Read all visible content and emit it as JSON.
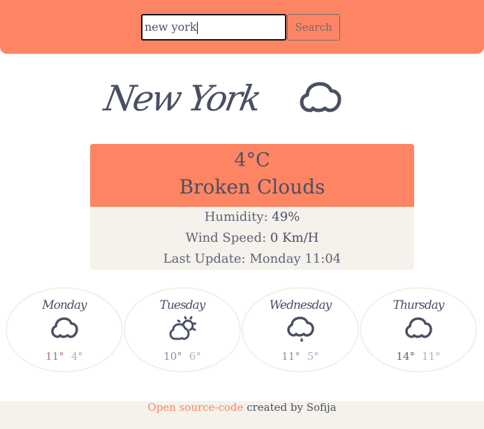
{
  "search": {
    "value": "new york",
    "button": "Search"
  },
  "city": "New York",
  "current": {
    "icon": "cloud-icon",
    "temperature": "4°C",
    "description": "Broken Clouds",
    "humidity_label": "Humidity:",
    "humidity": "49%",
    "wind_label": "Wind Speed:",
    "wind": "0 Km/H",
    "update_label": "Last Update:",
    "update": "Monday 11:04"
  },
  "forecast": [
    {
      "day": "Monday",
      "icon": "cloud-icon",
      "high": "11°",
      "low": "4°",
      "high_color": "#b0737a"
    },
    {
      "day": "Tuesday",
      "icon": "partly-sunny-icon",
      "high": "10°",
      "low": "6°",
      "high_color": "#8a90a8"
    },
    {
      "day": "Wednesday",
      "icon": "rain-cloud-icon",
      "high": "11°",
      "low": "5°",
      "high_color": "#9a8aa0"
    },
    {
      "day": "Thursday",
      "icon": "cloud-icon",
      "high": "14°",
      "low": "11°",
      "high_color": "#5b6478"
    }
  ],
  "footer": {
    "link": "Open source-code",
    "text": " created by Sofija"
  },
  "colors": {
    "accent": "#fe8563",
    "panel": "#f5f1eb",
    "text": "#4a4f63"
  }
}
